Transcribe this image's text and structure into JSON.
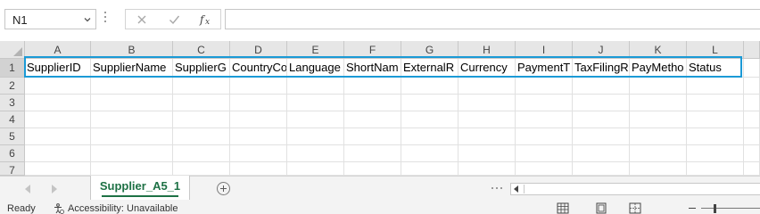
{
  "formula_bar": {
    "name_box": "N1",
    "cancel_icon": "x-icon",
    "enter_icon": "check-icon",
    "function_icon": "fx-icon",
    "formula_value": ""
  },
  "sheet": {
    "columns": [
      "A",
      "B",
      "C",
      "D",
      "E",
      "F",
      "G",
      "H",
      "I",
      "J",
      "K",
      "L"
    ],
    "rows": [
      "1",
      "2",
      "3",
      "4",
      "5",
      "6",
      "7"
    ],
    "row1": [
      "SupplierID",
      "SupplierName",
      "SupplierG",
      "CountryCo",
      "Language",
      "ShortNam",
      "ExternalR",
      "Currency",
      "PaymentT",
      "TaxFilingR",
      "PayMetho",
      "Status"
    ],
    "selected_cell": "N1",
    "selection_color": "#1b9ad6"
  },
  "tabs": {
    "active_sheet": "Supplier_A5_1",
    "add_sheet_icon": "plus-circle-icon",
    "accent": "#1e7145"
  },
  "status_bar": {
    "ready": "Ready",
    "accessibility": "Accessibility: Unavailable",
    "accessibility_icon": "accessibility-icon"
  }
}
